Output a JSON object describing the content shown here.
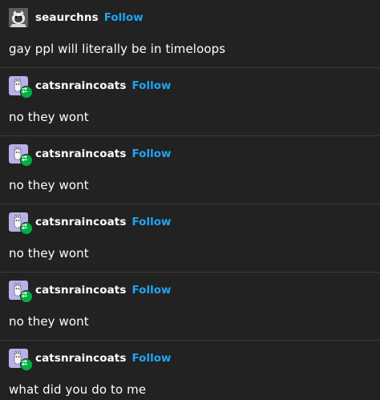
{
  "posts": [
    {
      "username": "seaurchns",
      "follow_label": "Follow",
      "body": "gay ppl will literally be in timeloops",
      "avatar_icon": "cat-avatar-icon",
      "reblogged": false
    },
    {
      "username": "catsnraincoats",
      "follow_label": "Follow",
      "body": "no they wont",
      "avatar_icon": "cat-avatar-icon",
      "reblogged": true
    },
    {
      "username": "catsnraincoats",
      "follow_label": "Follow",
      "body": "no they wont",
      "avatar_icon": "cat-avatar-icon",
      "reblogged": true
    },
    {
      "username": "catsnraincoats",
      "follow_label": "Follow",
      "body": "no they wont",
      "avatar_icon": "cat-avatar-icon",
      "reblogged": true
    },
    {
      "username": "catsnraincoats",
      "follow_label": "Follow",
      "body": "no they wont",
      "avatar_icon": "cat-avatar-icon",
      "reblogged": true
    },
    {
      "username": "catsnraincoats",
      "follow_label": "Follow",
      "body": "what did you do to me",
      "avatar_icon": "cat-avatar-icon",
      "reblogged": true
    }
  ],
  "colors": {
    "background": "#222222",
    "text": "#ffffff",
    "follow": "#21a4f3",
    "reblog_badge": "#00b043",
    "divider": "#3a3a3a"
  }
}
